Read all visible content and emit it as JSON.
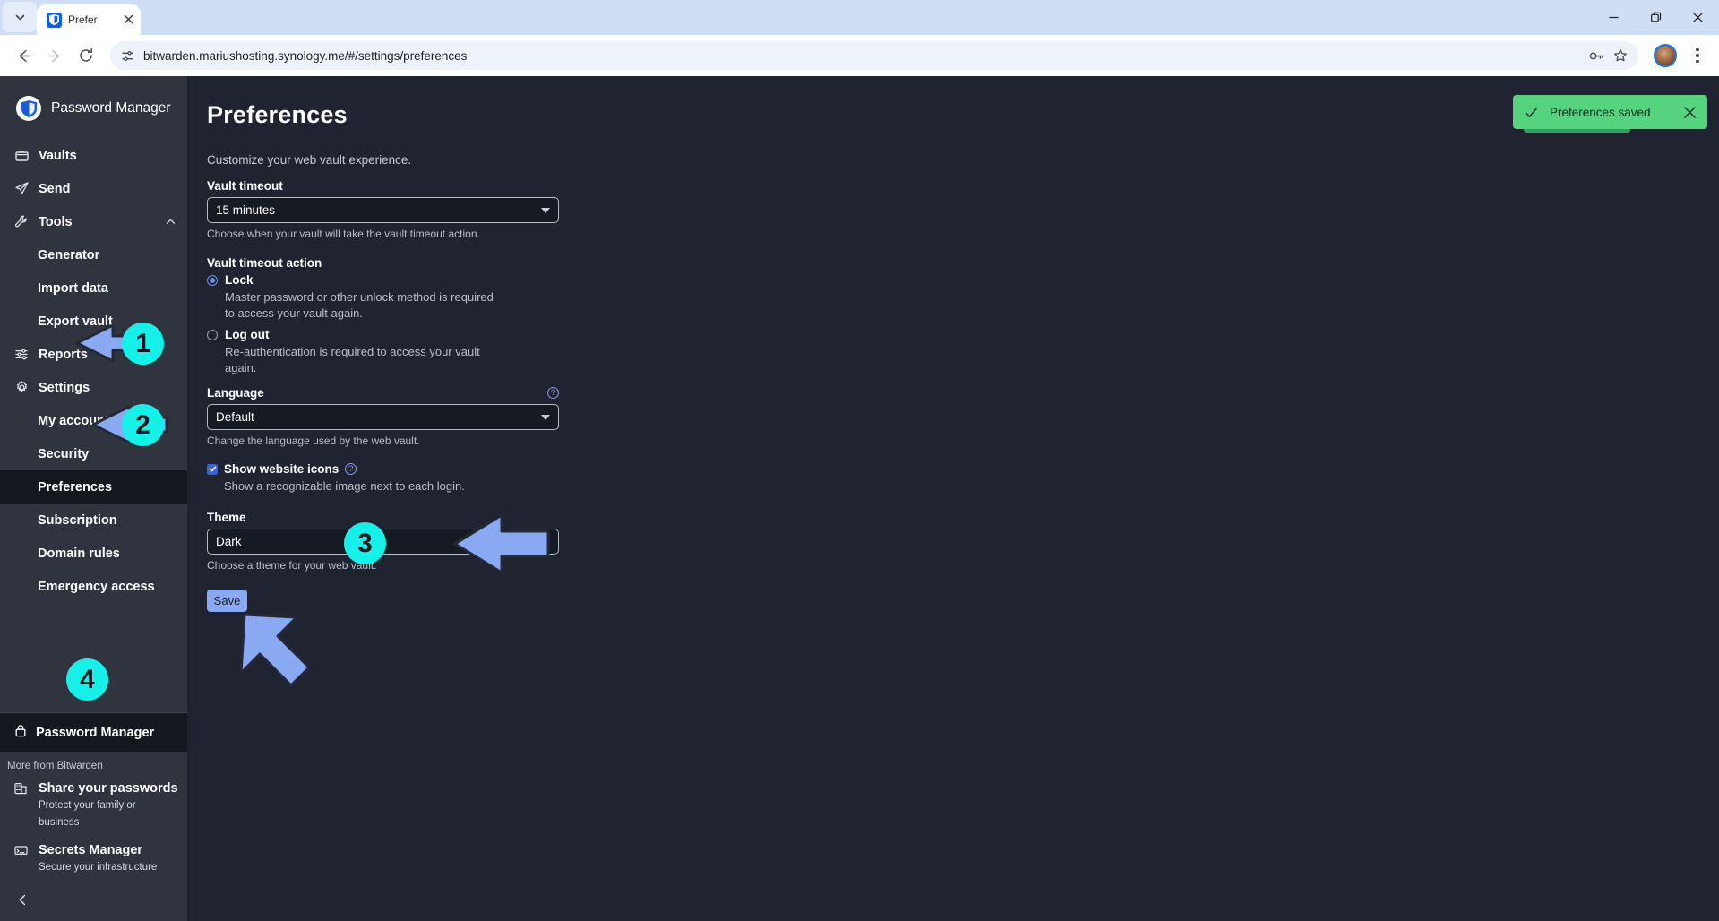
{
  "browser": {
    "tab": {
      "title": "Prefer",
      "favicon": "bitwarden-shield-icon",
      "close": "×"
    },
    "tab_list_icon": "chevron-down-icon",
    "window_controls": {
      "minimize": "minimize-icon",
      "maximize": "restore-icon",
      "close": "close-icon"
    },
    "nav": {
      "back": "back-arrow-icon",
      "forward": "forward-arrow-icon",
      "reload": "reload-icon"
    },
    "omnibox": {
      "url": "bitwarden.mariushosting.synology.me/#/settings/preferences",
      "site_info_icon": "tune-icon",
      "password_icon": "key-icon",
      "bookmark_icon": "star-icon"
    },
    "profile_icon": "profile-avatar",
    "menu_icon": "kebab-menu-icon"
  },
  "sidebar": {
    "brand": {
      "name": "Password Manager",
      "logo": "bitwarden-shield-icon"
    },
    "items": [
      {
        "label": "Vaults",
        "icon": "vault-icon",
        "sub": false,
        "active": false
      },
      {
        "label": "Send",
        "icon": "send-icon",
        "sub": false,
        "active": false
      },
      {
        "label": "Tools",
        "icon": "wrench-icon",
        "sub": false,
        "active": false,
        "chevron": "chevron-up-icon"
      },
      {
        "label": "Generator",
        "icon": "",
        "sub": true,
        "active": false
      },
      {
        "label": "Import data",
        "icon": "",
        "sub": true,
        "active": false
      },
      {
        "label": "Export vault",
        "icon": "",
        "sub": true,
        "active": false
      },
      {
        "label": "Reports",
        "icon": "reports-icon",
        "sub": false,
        "active": false
      },
      {
        "label": "Settings",
        "icon": "gear-icon",
        "sub": false,
        "active": false
      },
      {
        "label": "My account",
        "icon": "",
        "sub": true,
        "active": false
      },
      {
        "label": "Security",
        "icon": "",
        "sub": true,
        "active": false
      },
      {
        "label": "Preferences",
        "icon": "",
        "sub": true,
        "active": true
      },
      {
        "label": "Subscription",
        "icon": "",
        "sub": true,
        "active": false
      },
      {
        "label": "Domain rules",
        "icon": "",
        "sub": true,
        "active": false
      },
      {
        "label": "Emergency access",
        "icon": "",
        "sub": true,
        "active": false
      }
    ],
    "product_switch": {
      "label": "Password Manager",
      "icon": "lock-icon"
    },
    "more_label": "More from Bitwarden",
    "more_items": [
      {
        "title": "Share your passwords",
        "sub": "Protect your family or business",
        "icon": "organization-icon"
      },
      {
        "title": "Secrets Manager",
        "sub": "Secure your infrastructure",
        "icon": "secrets-manager-icon"
      }
    ],
    "collapse_icon": "chevron-left-icon"
  },
  "main": {
    "title": "Preferences",
    "subtitle": "Customize your web vault experience.",
    "vault_timeout": {
      "label": "Vault timeout",
      "value": "15 minutes",
      "help": "Choose when your vault will take the vault timeout action."
    },
    "vault_timeout_action": {
      "label": "Vault timeout action",
      "options": [
        {
          "label": "Lock",
          "checked": true,
          "desc": "Master password or other unlock method is required to access your vault again."
        },
        {
          "label": "Log out",
          "checked": false,
          "desc": "Re-authentication is required to access your vault again."
        }
      ]
    },
    "language": {
      "label": "Language",
      "value": "Default",
      "help": "Change the language used by the web vault.",
      "info_icon": "help-circle-icon"
    },
    "show_website_icons": {
      "label": "Show website icons",
      "checked": true,
      "desc": "Show a recognizable image next to each login.",
      "info_icon": "help-circle-icon"
    },
    "theme": {
      "label": "Theme",
      "value": "Dark",
      "help": "Choose a theme for your web vault."
    },
    "save_label": "Save"
  },
  "toast": {
    "message": "Preferences saved",
    "icon": "check-icon",
    "close_icon": "close-icon",
    "color": "#56d37e"
  },
  "annotations": {
    "marker_color": "#15f0e8",
    "arrow_color": "#89aaf2",
    "markers": [
      {
        "number": "1",
        "target": "sidebar-item-settings"
      },
      {
        "number": "2",
        "target": "sidebar-item-preferences"
      },
      {
        "number": "3",
        "target": "theme-select"
      },
      {
        "number": "4",
        "target": "save-button"
      }
    ]
  }
}
